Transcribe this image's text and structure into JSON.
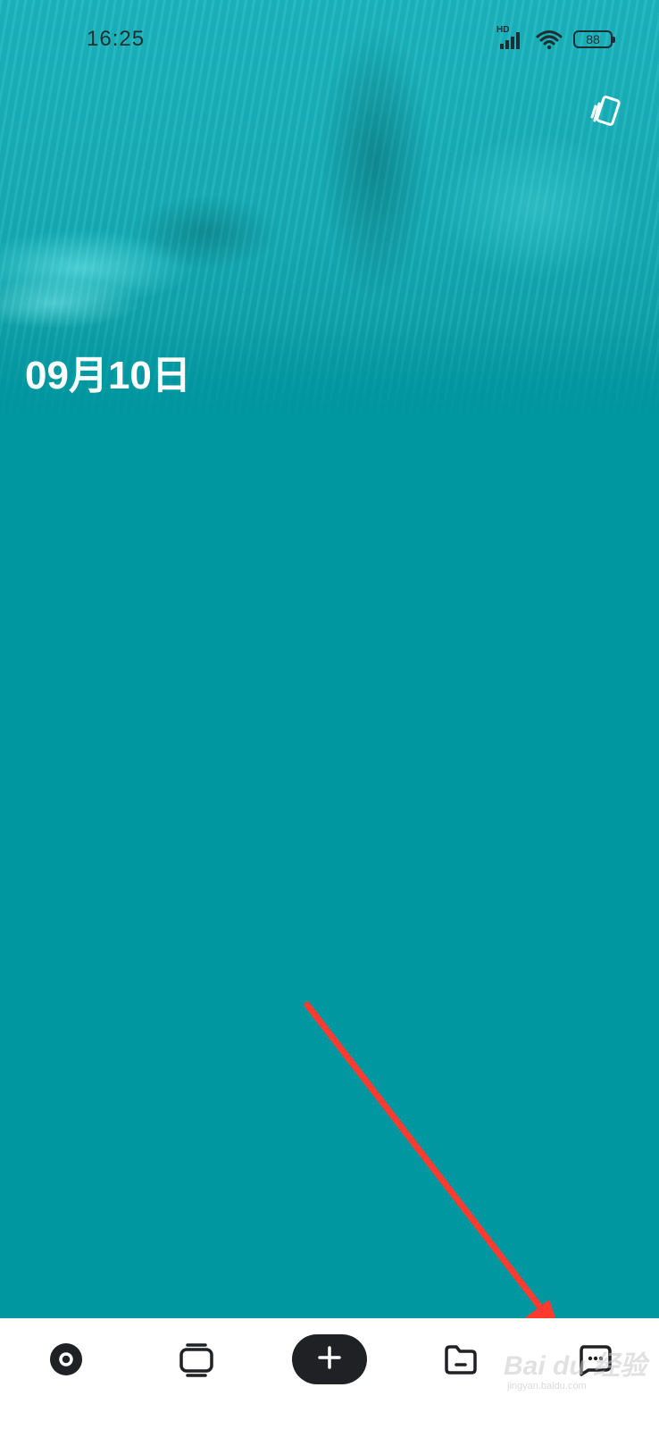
{
  "status_bar": {
    "time": "16:25",
    "network_badge": "HD",
    "battery": "88",
    "icons": [
      "signal-icon",
      "wifi-icon",
      "battery-icon"
    ]
  },
  "header": {
    "theme_button_icon": "skin-switch-icon",
    "date": "09月10日"
  },
  "colors": {
    "background": "#0097a0",
    "nav_background": "#ffffff",
    "add_button": "#202124",
    "annotation_arrow": "#ff3b30"
  },
  "bottom_nav": {
    "items": [
      {
        "icon": "record-disc-icon"
      },
      {
        "icon": "cards-stack-icon"
      },
      {
        "icon": "plus-icon"
      },
      {
        "icon": "folder-icon"
      },
      {
        "icon": "chat-bubble-icon"
      }
    ]
  },
  "watermark": {
    "logo": "Bai du 经验",
    "sub": "jingyan.baidu.com"
  }
}
